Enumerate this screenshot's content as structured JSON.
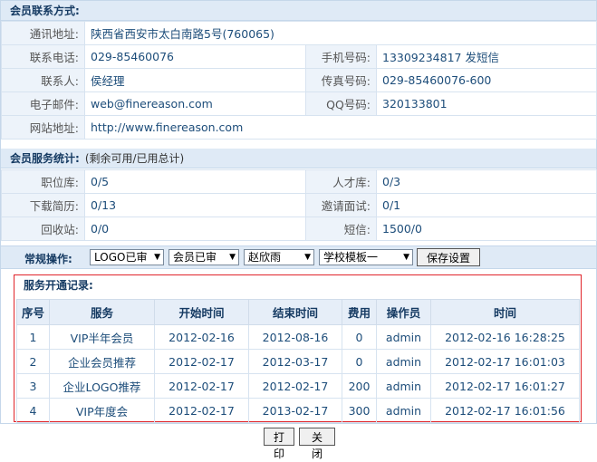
{
  "contact": {
    "title": "会员联系方式:",
    "address_label": "通讯地址:",
    "address": "陕西省西安市太白南路5号(760065)",
    "phone_label": "联系电话:",
    "phone": "029-85460076",
    "mobile_label": "手机号码:",
    "mobile": "13309234817 发短信",
    "person_label": "联系人:",
    "person": "侯经理",
    "fax_label": "传真号码:",
    "fax": "029-85460076-600",
    "email_label": "电子邮件:",
    "email": "web@finereason.com",
    "qq_label": "QQ号码:",
    "qq": "320133801",
    "website_label": "网站地址:",
    "website": "http://www.finereason.com"
  },
  "stats": {
    "title": "会员服务统计:",
    "note": "(剩余可用/已用总计)",
    "jobs_label": "职位库:",
    "jobs": "0/5",
    "talent_label": "人才库:",
    "talent": "0/3",
    "resume_label": "下载简历:",
    "resume": "0/13",
    "invite_label": "邀请面试:",
    "invite": "0/1",
    "recycle_label": "回收站:",
    "recycle": "0/0",
    "sms_label": "短信:",
    "sms": "1500/0"
  },
  "ops": {
    "label": "常规操作:",
    "logo_select": "LOGO已审",
    "member_select": "会员已审",
    "staff_select": "赵欣雨",
    "template_select": "学校模板一",
    "save_label": "保存设置"
  },
  "records": {
    "title": "服务开通记录:",
    "headers": [
      "序号",
      "服务",
      "开始时间",
      "结束时间",
      "费用",
      "操作员",
      "时间"
    ],
    "rows": [
      [
        "1",
        "VIP半年会员",
        "2012-02-16",
        "2012-08-16",
        "0",
        "admin",
        "2012-02-16 16:28:25"
      ],
      [
        "2",
        "企业会员推荐",
        "2012-02-17",
        "2012-03-17",
        "0",
        "admin",
        "2012-02-17 16:01:03"
      ],
      [
        "3",
        "企业LOGO推荐",
        "2012-02-17",
        "2012-02-17",
        "200",
        "admin",
        "2012-02-17 16:01:27"
      ],
      [
        "4",
        "VIP年度会",
        "2012-02-17",
        "2013-02-17",
        "300",
        "admin",
        "2012-02-17 16:01:56"
      ]
    ]
  },
  "footer": {
    "print_label": "打印",
    "close_label": "关 闭"
  }
}
